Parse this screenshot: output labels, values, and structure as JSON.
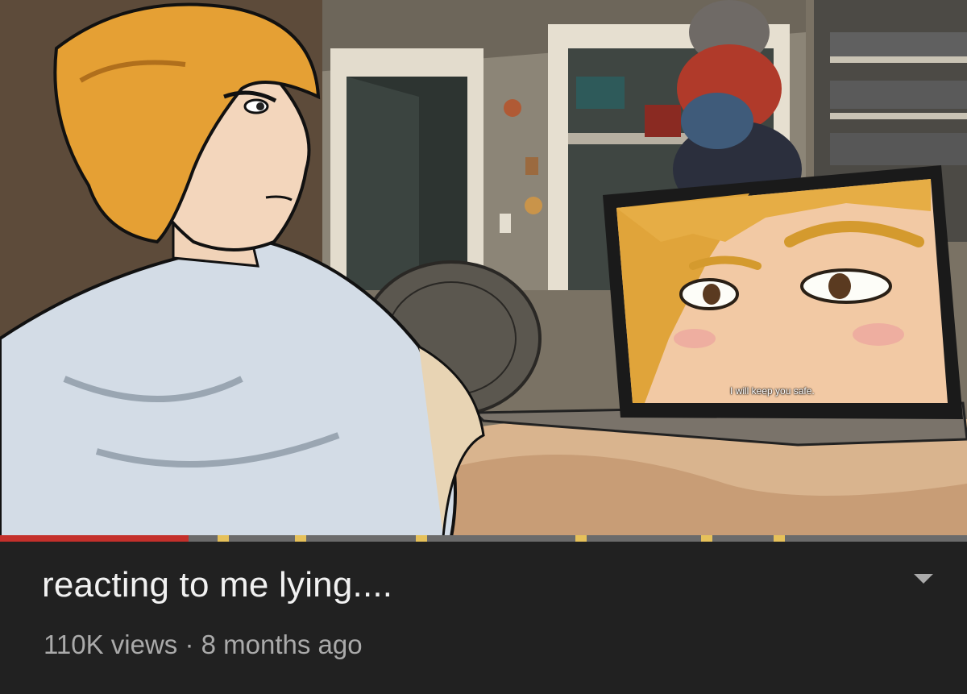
{
  "video": {
    "title": "reacting to me lying....",
    "views": "110K views",
    "separator": " · ",
    "age": "8 months ago",
    "progress_fraction": 0.195,
    "chapter_marks_fraction": [
      0.225,
      0.305,
      0.43,
      0.595,
      0.725,
      0.8
    ]
  },
  "thumbnail": {
    "subtitle": "I will keep you safe."
  },
  "icons": {
    "expand": "chevron-down-icon"
  },
  "colors": {
    "background": "#212121",
    "title": "#f1f1f1",
    "meta": "#aaaaaa",
    "progress": "#c4302b"
  }
}
